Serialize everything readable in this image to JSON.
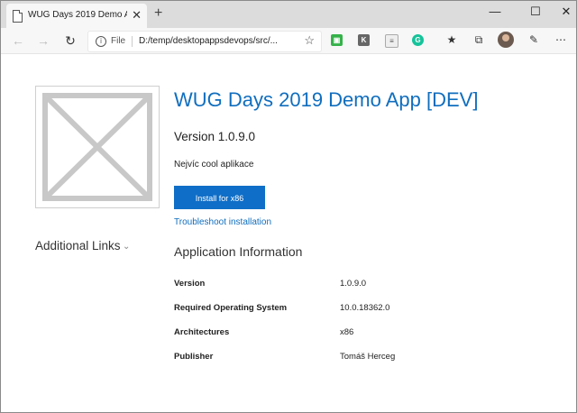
{
  "browser": {
    "tab_title": "WUG Days 2019 Demo App [DEV]",
    "tab_close": "✕",
    "new_tab": "+",
    "window_controls": {
      "minimize": "—",
      "maximize": "☐",
      "close": "✕"
    },
    "address": {
      "protocol_label": "File",
      "url": "D:/temp/desktopappsdevops/src/..."
    },
    "icons": [
      "back-arrow-icon",
      "forward-arrow-icon",
      "refresh-icon",
      "info-icon",
      "favorite-star-icon",
      "reader-icon",
      "k-extension-icon",
      "bookmark-icon",
      "grammarly-icon",
      "favorites-icon",
      "collections-icon",
      "profile-avatar",
      "feedback-icon",
      "more-icon"
    ]
  },
  "page": {
    "title": "WUG Days 2019 Demo App [DEV]",
    "version_heading": "Version 1.0.9.0",
    "description": "Nejvíc cool aplikace",
    "install_button": "Install for x86",
    "troubleshoot_link": "Troubleshoot installation",
    "additional_links": "Additional Links",
    "info_heading": "Application Information",
    "info_rows": [
      {
        "label": "Version",
        "value": "1.0.9.0"
      },
      {
        "label": "Required Operating System",
        "value": "10.0.18362.0"
      },
      {
        "label": "Architectures",
        "value": "x86"
      },
      {
        "label": "Publisher",
        "value": "Tomáš Herceg"
      }
    ]
  },
  "colors": {
    "accent": "#106ebe",
    "button": "#0f6ec7",
    "tabbar": "#dcdcdc",
    "toolbar": "#f7f7f7"
  }
}
